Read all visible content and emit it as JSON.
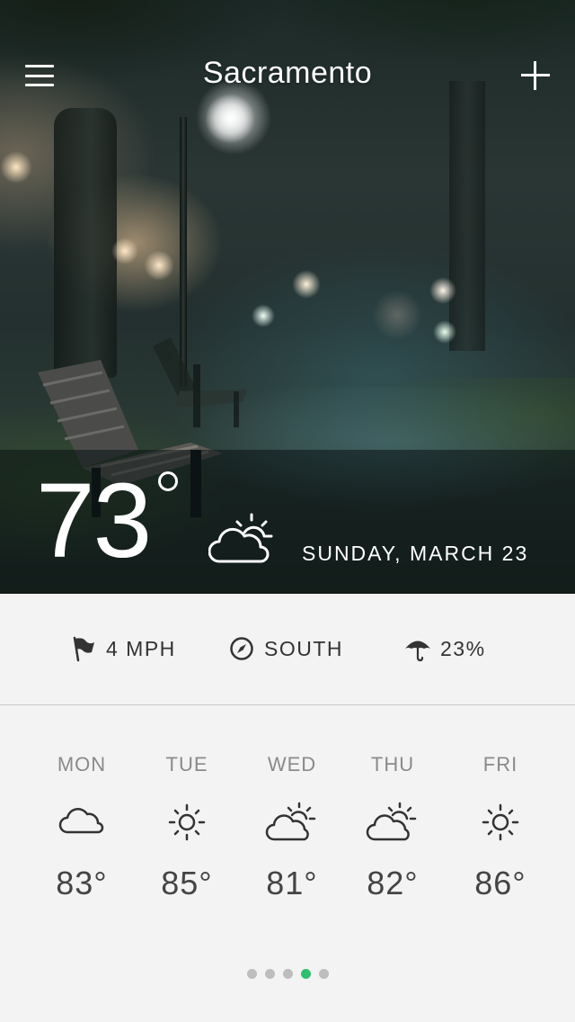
{
  "header": {
    "city": "Sacramento",
    "menu_icon": "hamburger-menu-icon",
    "add_icon": "plus-icon"
  },
  "current": {
    "temperature": "73",
    "condition_icon": "partly-cloudy-icon",
    "date": "SUNDAY, MARCH 23"
  },
  "stats": {
    "wind_speed": {
      "icon": "flag-icon",
      "value": "4 MPH"
    },
    "wind_direction": {
      "icon": "compass-icon",
      "value": "SOUTH"
    },
    "precipitation": {
      "icon": "umbrella-icon",
      "value": "23%"
    }
  },
  "forecast": [
    {
      "day": "MON",
      "icon": "cloud-icon",
      "temp": "83°"
    },
    {
      "day": "TUE",
      "icon": "sun-icon",
      "temp": "85°"
    },
    {
      "day": "WED",
      "icon": "partly-cloudy-icon",
      "temp": "81°"
    },
    {
      "day": "THU",
      "icon": "partly-cloudy-icon",
      "temp": "82°"
    },
    {
      "day": "FRI",
      "icon": "sun-icon",
      "temp": "86°"
    }
  ],
  "pager": {
    "count": 5,
    "active_index": 3
  },
  "colors": {
    "accent": "#2fbf6c",
    "background": "#f3f3f3",
    "text": "#333333",
    "muted": "#8a8a8a"
  }
}
